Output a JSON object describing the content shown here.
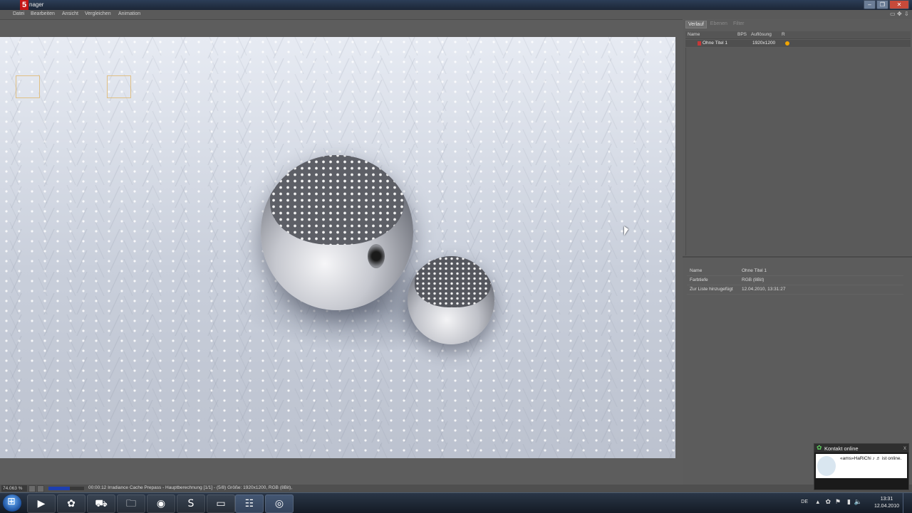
{
  "window": {
    "logo": "5",
    "title": "nager",
    "controls": [
      "–",
      "❐",
      "✕"
    ]
  },
  "menu": [
    "Datei",
    "Bearbeiten",
    "Ansicht",
    "Vergleichen",
    "Animation"
  ],
  "panel_icons": [
    "▭",
    "✥",
    "⇩"
  ],
  "side": {
    "tabs": [
      "Verlauf",
      "Ebenen",
      "Filter"
    ],
    "columns": [
      "Name",
      "BPS",
      "Auflösung",
      "R"
    ],
    "row": {
      "name": "Ohne Titel 1",
      "resolution": "1920x1200"
    },
    "info": [
      {
        "label": "Name",
        "value": "Ohne Titel 1"
      },
      {
        "label": "Farbtiefe",
        "value": "RGB (8Bit)"
      },
      {
        "label": "Zur Liste hinzugefügt",
        "value": "12.04.2010, 13:31:27"
      }
    ]
  },
  "status": {
    "zoom": "74.063 %",
    "progress": 0.6,
    "text": "00:00:12 Irradiance Cache Prepass - Hauptberechnung [1/1] - (5/8)  Größe: 1920x1200, RGB (8Bit),"
  },
  "taskbar": {
    "apps": [
      "▶",
      "✿",
      "⛟",
      "🗀",
      "◉",
      "S",
      "▭",
      "☷",
      "◎"
    ],
    "lang": "DE",
    "time": "13:31",
    "date": "12.04.2010",
    "tray_icons": [
      "▴",
      "✿",
      "⚑",
      "▮",
      "🔈"
    ]
  },
  "notification": {
    "title": "Kontakt online",
    "close": "x",
    "text": "«ams»HaRiChi ♪ ♬ ist online."
  },
  "colors": {
    "accent_red": "#c41616",
    "progress_blue": "#1d3fb0",
    "status_dot": "#f0a400"
  }
}
